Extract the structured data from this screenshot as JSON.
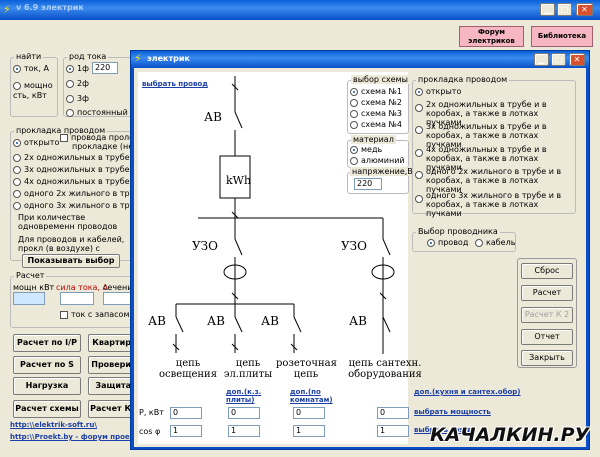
{
  "main_window": {
    "title": "v 6.9 электрик",
    "forum_button": "Форум электриков",
    "library_button": "Библиотека",
    "find_label": "найти",
    "find_current": "ток, А",
    "find_power": "мощно сть, кВт",
    "current_type_label": "род тока",
    "phase1": "1ф",
    "voltage": "220",
    "phase2": "2ф",
    "phase3": "3ф",
    "dc": "постоянный",
    "laying_label": "прокладка проводом",
    "laying_options": [
      "открыто",
      "2х одножильных в трубе и в к",
      "3х одножильных в трубе и в к",
      "4х одножильных в трубе и в к",
      "одного 2х жильного в трубе и",
      "одного 3х жильного в трубе и"
    ],
    "laying_side1": "провода проложе",
    "laying_side2": "прокладке (не б",
    "note1": "При количестве одновременн проводов проложенных открыт",
    "note2": "Для проводов и кабелей, прокл (в воздухе) с применением пр",
    "show_choice": "Показывать выбор",
    "calc_label": "Расчет",
    "power_kw": "мощн кВт",
    "current_label": "сила тока, А",
    "section_label": "сечени",
    "with_reserve": "ток с запасом",
    "calc_by_ip": "Расчет по I/P",
    "apartment": "Квартир",
    "calc_by_s": "Расчет по S",
    "check": "Провери",
    "load": "Нагрузка",
    "protect": "Защита",
    "calc_scheme": "Расчет схемы",
    "calc_k": "Расчет К",
    "link1": "http:\\\\elektrik-soft.ru\\",
    "link2": "http:\\\\Proekt.by - форум проек"
  },
  "dialog": {
    "title": "электрик",
    "choose_wire": "выбрать провод",
    "scheme_label": "выбор схемы",
    "schemes": [
      "схема №1",
      "схема №2",
      "схема №3",
      "схема №4"
    ],
    "material_label": "материал",
    "copper": "медь",
    "aluminum": "алюминий",
    "voltage_label": "напряжение,В",
    "voltage_value": "220",
    "laying_label": "прокладка проводом",
    "laying": [
      "открыто",
      "2х одножильных в трубе и в коробах, а также в лотках пучками",
      "3х одножильных в трубе и в коробах, а также в лотках пучками",
      "4х одножильных в трубе и в коробах, а также в лотках пучками",
      "одного 2х жильного в трубе и в коробах, а также в лотках пучками",
      "одного 3х жильного в трубе и в коробах, а также в лотках пучками"
    ],
    "conductor_label": "Выбор проводника",
    "wire": "провод",
    "cable": "кабель",
    "buttons": {
      "reset": "Сброс",
      "calc": "Расчет",
      "calc_k2": "Расчет К 2",
      "report": "Отчет",
      "close": "Закрыть"
    },
    "diagram": {
      "ab": "АВ",
      "meter": "kWh",
      "uzo": "УЗО",
      "circuits": [
        "цепь освещения",
        "цепь эл.плиты",
        "розеточная цепь",
        "цепь сантехн. оборудования"
      ],
      "sub_links": [
        "доп.(к.з. плиты)",
        "доп.(по комнатам)"
      ],
      "extra_link": "доп.(кухня и сантех.обор)"
    },
    "row_p": "Р, кВт",
    "row_cos": "cos φ",
    "p_values": [
      "0",
      "0",
      "0",
      "0"
    ],
    "cos_values": [
      "1",
      "1",
      "1",
      "1"
    ],
    "choose_power": "выбрать мощность",
    "choose_cos": "выбрать cos φ"
  },
  "watermark": "КАЧАЛКИН.РУ"
}
